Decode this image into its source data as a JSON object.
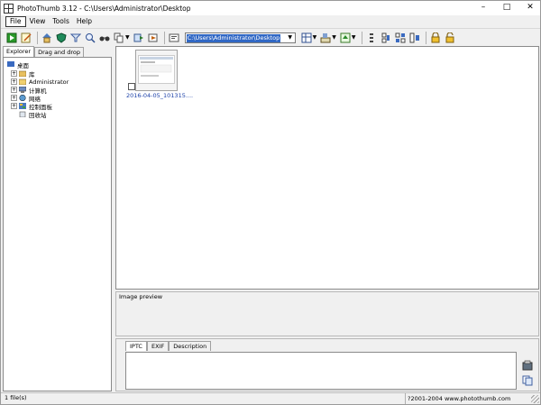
{
  "window": {
    "title": "PhotoThumb 3.12 - C:\\Users\\Administrator\\Desktop",
    "minimize": "–",
    "maximize": "□",
    "close": "✕"
  },
  "menu": {
    "items": [
      "File",
      "View",
      "Tools",
      "Help"
    ]
  },
  "toolbar": {
    "path_value": "C:\\Users\\Administrator\\Desktop",
    "icons": [
      "run-icon",
      "edit-icon",
      "home-icon",
      "shield-icon",
      "filter-icon",
      "zoom-icon",
      "glasses-icon",
      "copy-icon",
      "move-icon",
      "open-icon",
      "view-mode-icon",
      "sort-icon",
      "export-icon",
      "rotate-icon",
      "lock-icon",
      "unlock-icon"
    ]
  },
  "left_panel": {
    "tabs": [
      "Explorer",
      "Drag and drop"
    ],
    "tree": [
      {
        "label": "桌面",
        "icon": "desktop-icon"
      },
      {
        "label": "库",
        "icon": "library-icon"
      },
      {
        "label": "Administrator",
        "icon": "user-icon"
      },
      {
        "label": "计算机",
        "icon": "computer-icon"
      },
      {
        "label": "网络",
        "icon": "network-icon"
      },
      {
        "label": "控制面板",
        "icon": "control-panel-icon"
      },
      {
        "label": "回收站",
        "icon": "recycle-bin-icon"
      }
    ]
  },
  "thumbs": [
    {
      "label": "2016-04-05_101315...."
    }
  ],
  "preview": {
    "title": "Image preview"
  },
  "meta": {
    "tabs": [
      "IPTC",
      "EXIF",
      "Description"
    ]
  },
  "status": {
    "left": "1 file(s)",
    "right": "?2001-2004 www.photothumb.com"
  },
  "colors": {
    "selection": "#3168c5",
    "link": "#1a3fa8"
  }
}
